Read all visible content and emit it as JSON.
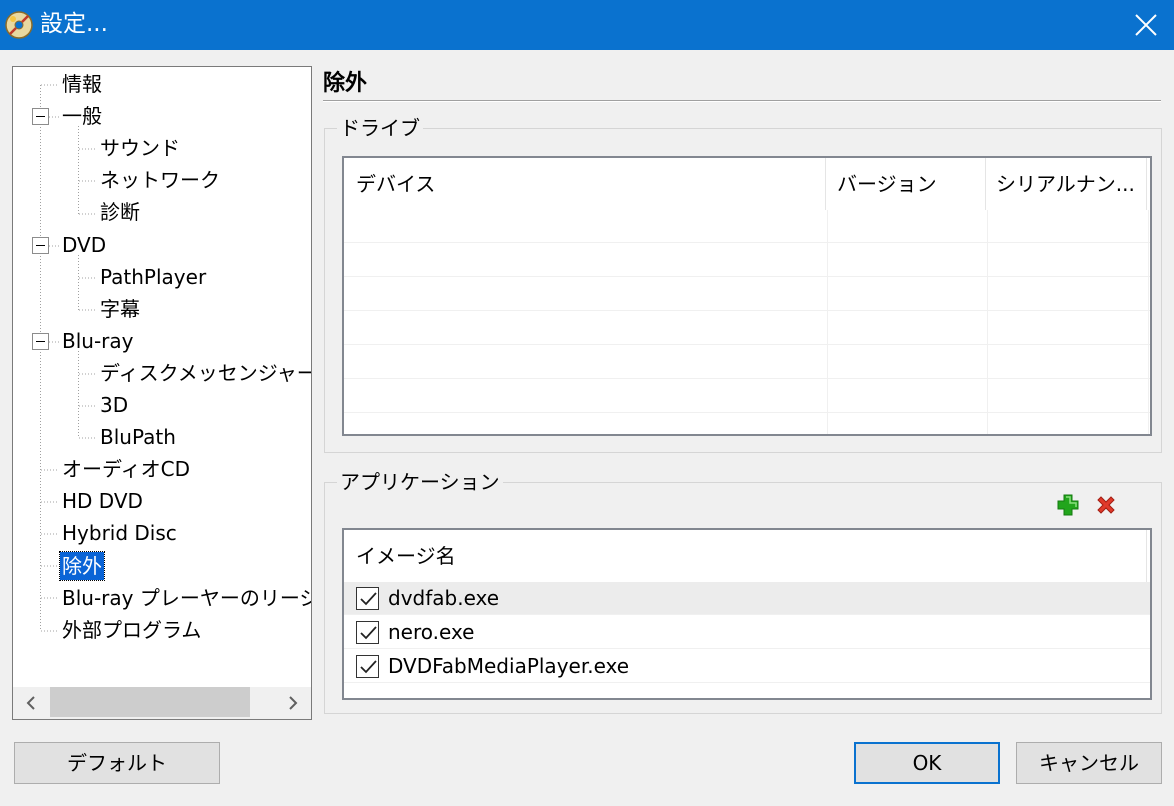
{
  "window": {
    "title": "設定...",
    "icon": "app-disc-icon",
    "close_icon": "close-icon"
  },
  "tree": {
    "items": [
      {
        "label": "情報",
        "level": 0,
        "expander": false,
        "selected": false
      },
      {
        "label": "一般",
        "level": 0,
        "expander": true,
        "selected": false
      },
      {
        "label": "サウンド",
        "level": 1,
        "expander": false,
        "selected": false
      },
      {
        "label": "ネットワーク",
        "level": 1,
        "expander": false,
        "selected": false
      },
      {
        "label": "診断",
        "level": 1,
        "expander": false,
        "selected": false
      },
      {
        "label": "DVD",
        "level": 0,
        "expander": true,
        "selected": false
      },
      {
        "label": "PathPlayer",
        "level": 1,
        "expander": false,
        "selected": false
      },
      {
        "label": "字幕",
        "level": 1,
        "expander": false,
        "selected": false
      },
      {
        "label": "Blu-ray",
        "level": 0,
        "expander": true,
        "selected": false
      },
      {
        "label": "ディスクメッセンジャー",
        "level": 1,
        "expander": false,
        "selected": false
      },
      {
        "label": "3D",
        "level": 1,
        "expander": false,
        "selected": false
      },
      {
        "label": "BluPath",
        "level": 1,
        "expander": false,
        "selected": false
      },
      {
        "label": "オーディオCD",
        "level": 0,
        "expander": false,
        "selected": false
      },
      {
        "label": "HD DVD",
        "level": 0,
        "expander": false,
        "selected": false
      },
      {
        "label": "Hybrid Disc",
        "level": 0,
        "expander": false,
        "selected": false
      },
      {
        "label": "除外",
        "level": 0,
        "expander": false,
        "selected": true
      },
      {
        "label": "Blu-ray プレーヤーのリージ",
        "level": 0,
        "expander": false,
        "selected": false
      },
      {
        "label": "外部プログラム",
        "level": 0,
        "expander": false,
        "selected": false
      }
    ],
    "scroll_left_icon": "chevron-left-icon",
    "scroll_right_icon": "chevron-right-icon"
  },
  "section": {
    "title": "除外"
  },
  "drives": {
    "group_label": "ドライブ",
    "columns": [
      "デバイス",
      "バージョン",
      "シリアルナン..."
    ],
    "rows": []
  },
  "applications": {
    "group_label": "アプリケーション",
    "add_icon": "plus-icon",
    "remove_icon": "delete-icon",
    "add_color": "#22a51c",
    "remove_color": "#e03a2b",
    "column": "イメージ名",
    "items": [
      {
        "name": "dvdfab.exe",
        "checked": true
      },
      {
        "name": "nero.exe",
        "checked": true
      },
      {
        "name": "DVDFabMediaPlayer.exe",
        "checked": true
      }
    ]
  },
  "buttons": {
    "default_label": "デフォルト",
    "ok_label": "OK",
    "cancel_label": "キャンセル"
  },
  "colors": {
    "titlebar": "#0a72cf",
    "selection": "#0a64d6"
  }
}
